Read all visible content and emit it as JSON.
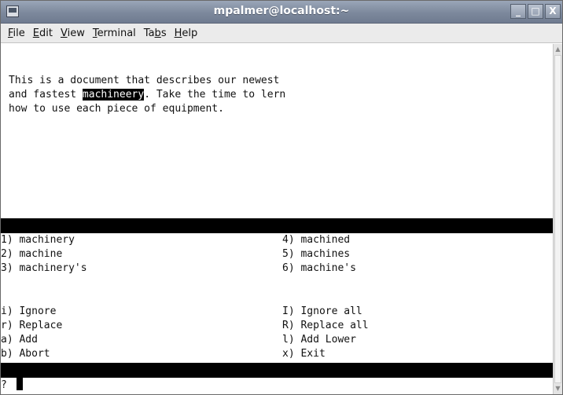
{
  "window": {
    "title": "mpalmer@localhost:~",
    "buttons": {
      "minimize": "_",
      "maximize": "□",
      "close": "X"
    }
  },
  "menu": [
    {
      "pre": "",
      "ul": "F",
      "post": "ile"
    },
    {
      "pre": "",
      "ul": "E",
      "post": "dit"
    },
    {
      "pre": "",
      "ul": "V",
      "post": "iew"
    },
    {
      "pre": "",
      "ul": "T",
      "post": "erminal"
    },
    {
      "pre": "Ta",
      "ul": "b",
      "post": "s"
    },
    {
      "pre": "",
      "ul": "H",
      "post": "elp"
    }
  ],
  "document": {
    "line1": "This is a document that describes our newest",
    "line2_pre": "and fastest ",
    "line2_word": "machineery",
    "line2_post": ". Take the time to lern",
    "line3": "how to use each piece of equipment."
  },
  "suggestions": {
    "left": [
      "1) machinery",
      "2) machine",
      "3) machinery's"
    ],
    "right": [
      "4) machined",
      "5) machines",
      "6) machine's"
    ]
  },
  "actions": {
    "left": [
      "i) Ignore",
      "r) Replace",
      "a) Add",
      "b) Abort"
    ],
    "right": [
      "I) Ignore all",
      "R) Replace all",
      "l) Add Lower",
      "x) Exit"
    ]
  },
  "prompt": "?"
}
